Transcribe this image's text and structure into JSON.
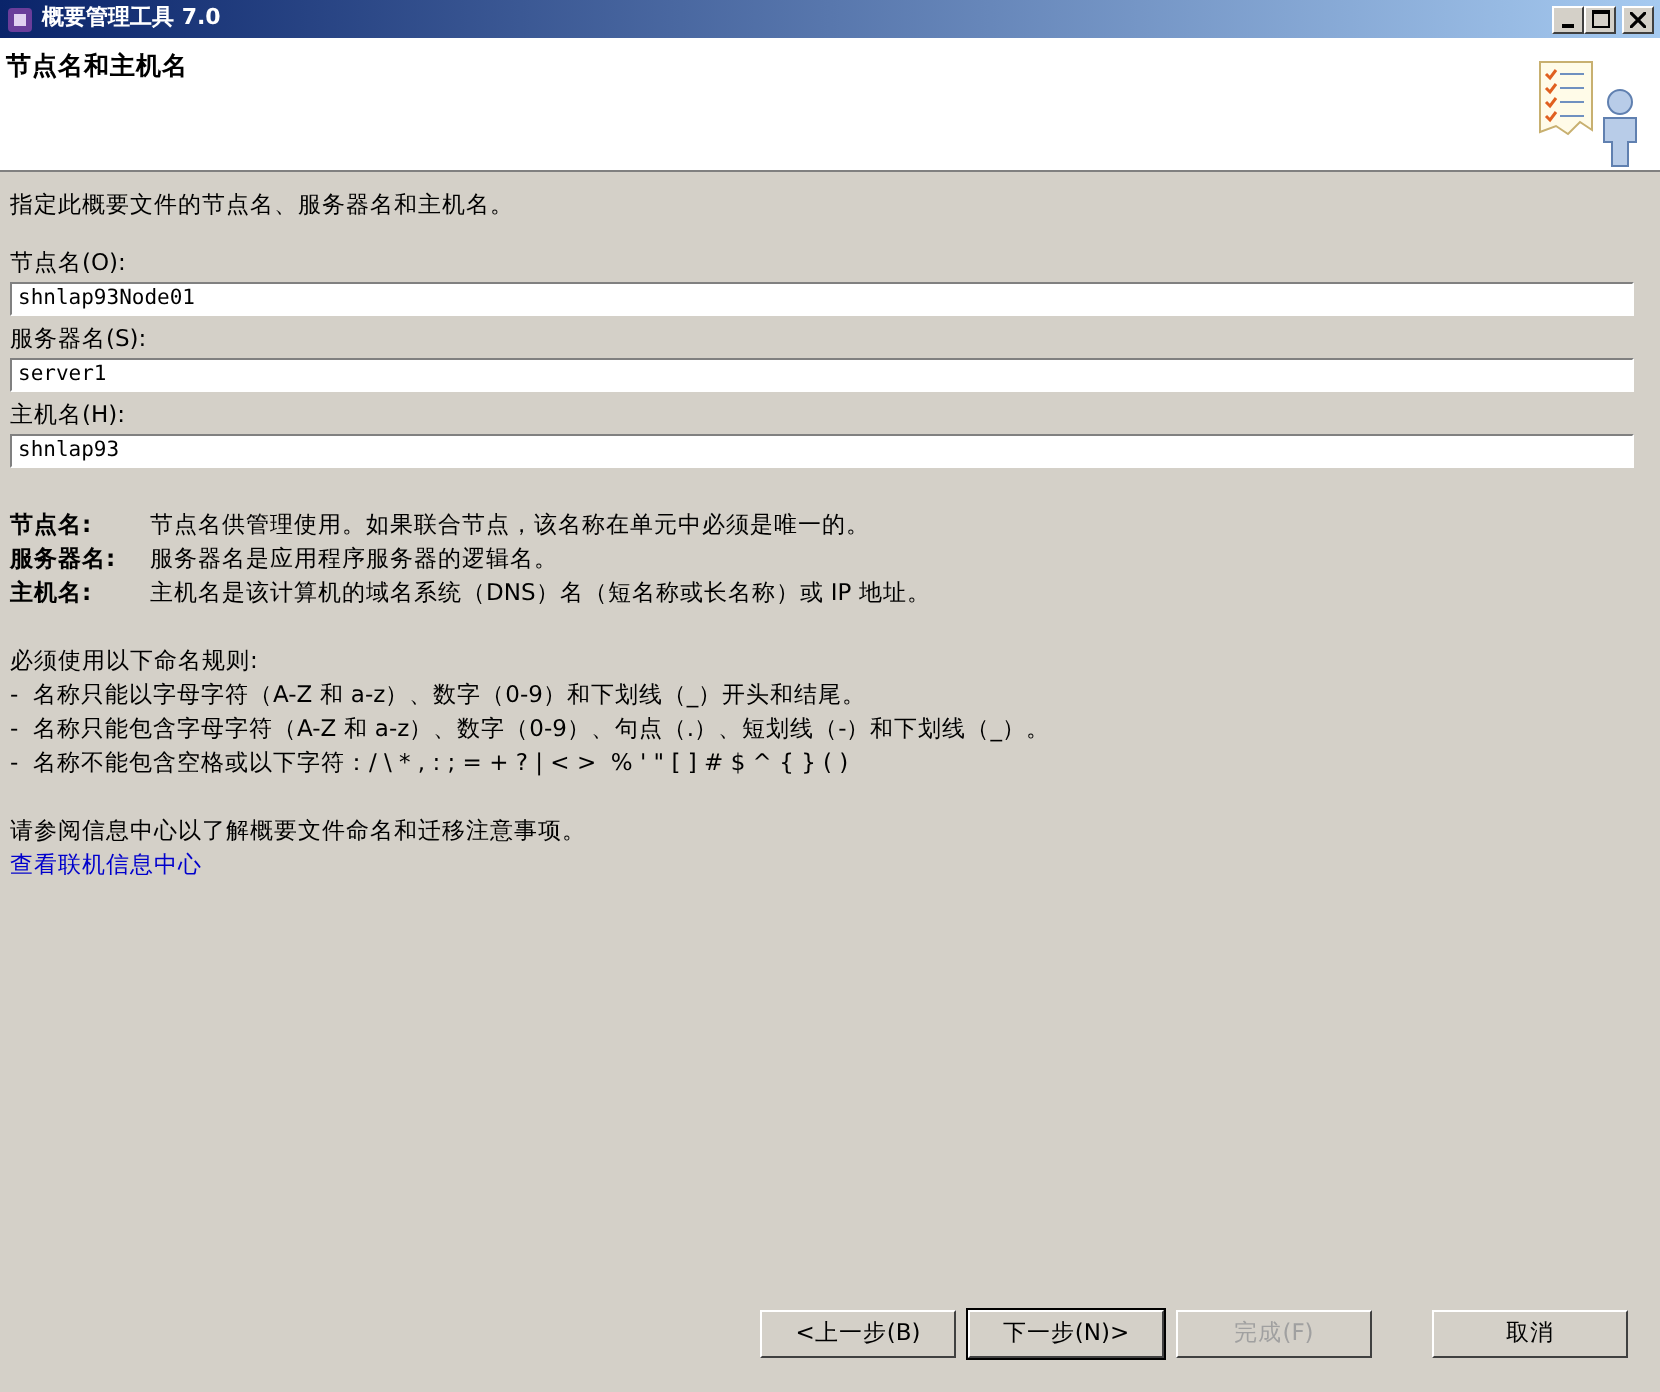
{
  "window": {
    "title": "概要管理工具 7.0"
  },
  "header": {
    "title": "节点名和主机名"
  },
  "description": "指定此概要文件的节点名、服务器名和主机名。",
  "fields": [
    {
      "label": "节点名(O):",
      "value": "shnlap93Node01"
    },
    {
      "label": "服务器名(S):",
      "value": "server1"
    },
    {
      "label": "主机名(H):",
      "value": "shnlap93"
    }
  ],
  "definitions": [
    {
      "term": "节点名:",
      "text": "节点名供管理使用。如果联合节点，该名称在单元中必须是唯一的。"
    },
    {
      "term": "服务器名:",
      "text": "服务器名是应用程序服务器的逻辑名。"
    },
    {
      "term": "主机名:",
      "text": "主机名是该计算机的域名系统（DNS）名（短名称或长名称）或 IP 地址。"
    }
  ],
  "rules_heading": "必须使用以下命名规则:",
  "rules": [
    "-  名称只能以字母字符（A-Z 和 a-z）、数字（0-9）和下划线（_）开头和结尾。",
    "-  名称只能包含字母字符（A-Z 和 a-z）、数字（0-9）、句点（.）、短划线（-）和下划线（_）。",
    "-  名称不能包含空格或以下字符：/ \\ * , : ; = + ? | < >  % ' \" [ ] # $ ^ { } ( )"
  ],
  "note": "请参阅信息中心以了解概要文件命名和迁移注意事项。",
  "link": "查看联机信息中心",
  "buttons": [
    {
      "label": "<上一步(B)",
      "disabled": false,
      "default": false
    },
    {
      "label": "下一步(N)>",
      "disabled": false,
      "default": true
    },
    {
      "label": "完成(F)",
      "disabled": true,
      "default": false
    },
    {
      "label": "取消",
      "disabled": false,
      "default": false
    }
  ]
}
